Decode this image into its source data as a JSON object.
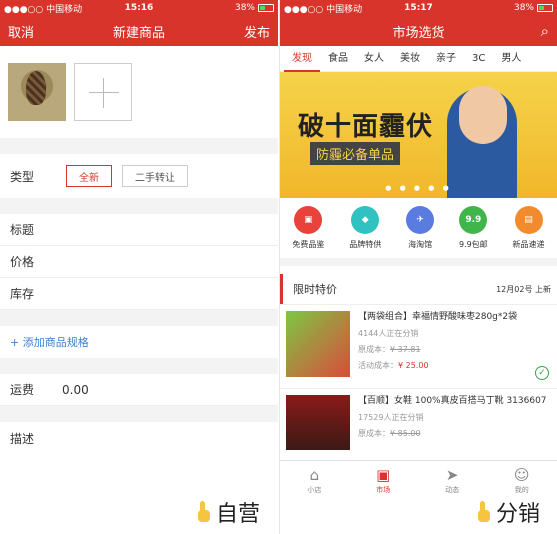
{
  "left": {
    "status": {
      "carrier": "●●●○○ 中国移动",
      "time": "15:16",
      "battery": "38%"
    },
    "nav": {
      "cancel": "取消",
      "title": "新建商品",
      "publish": "发布"
    },
    "type_label": "类型",
    "type_options": [
      "全新",
      "二手转让"
    ],
    "fields": [
      "标题",
      "价格",
      "库存"
    ],
    "add_spec": "+ 添加商品规格",
    "freight_label": "运费",
    "freight_value": "0.00",
    "desc_label": "描述",
    "caption": "自营"
  },
  "right": {
    "status": {
      "carrier": "●●●○○ 中国移动",
      "time": "15:17",
      "battery": "38%"
    },
    "nav": {
      "title": "市场选货"
    },
    "tabs": [
      "发现",
      "食品",
      "女人",
      "美妆",
      "亲子",
      "3C",
      "男人"
    ],
    "banner": {
      "title": "破十面霾伏",
      "subtitle": "防霾必备单品"
    },
    "icons": [
      {
        "label": "免费品鉴",
        "color": "#e8423a",
        "glyph": "▣"
      },
      {
        "label": "品牌特供",
        "color": "#2fc2c0",
        "glyph": "◆"
      },
      {
        "label": "海淘馆",
        "color": "#5a7be0",
        "glyph": "✈"
      },
      {
        "label": "9.9包邮",
        "color": "#3fb54a",
        "glyph": "9.9"
      },
      {
        "label": "新品速递",
        "color": "#f28a2e",
        "glyph": "▤"
      }
    ],
    "section": {
      "title": "限时特价",
      "date": "12月02号 上新"
    },
    "items": [
      {
        "name": "【两袋组合】幸福情野酸味枣280g*2袋",
        "people": "4144人正在分销",
        "orig_label": "原成本：",
        "orig": "¥ 37.81",
        "act_label": "活动成本：",
        "act": "¥ 25.00"
      },
      {
        "name": "【百顺】女鞋 100%真皮百搭马丁靴 3136607",
        "people": "17529人正在分销",
        "orig_label": "原成本：",
        "orig": "¥ 85.00"
      }
    ],
    "tabbar": [
      "小店",
      "市场",
      "动态",
      "我的"
    ],
    "caption": "分销"
  }
}
